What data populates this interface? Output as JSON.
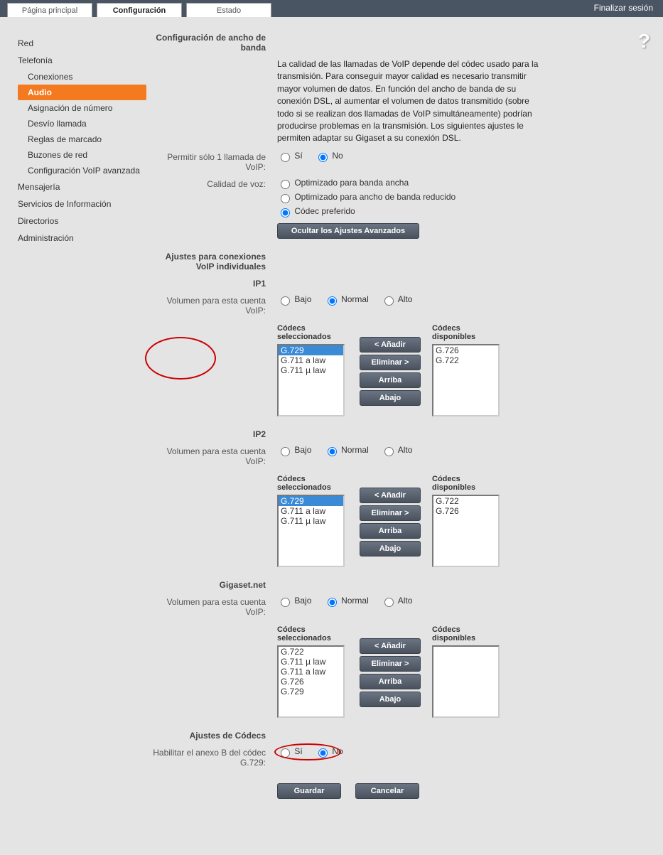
{
  "topbar": {
    "tabs": [
      "Página principal",
      "Configuración",
      "Estado"
    ],
    "logout": "Finalizar sesión"
  },
  "sidebar": {
    "red": "Red",
    "telefonia": "Telefonía",
    "telefonia_items": {
      "conexiones": "Conexiones",
      "audio": "Audio",
      "asignacion": "Asignación de número",
      "desvio": "Desvío llamada",
      "reglas": "Reglas de marcado",
      "buzones": "Buzones de red",
      "avanzada": "Configuración VoIP avanzada"
    },
    "mensajeria": "Mensajería",
    "servicios": "Servicios de Información",
    "directorios": "Directorios",
    "administracion": "Administración"
  },
  "content": {
    "heading_banda": "Configuración de ancho de banda",
    "desc": "La calidad de las llamadas de VoIP depende del códec usado para la transmisión. Para conseguir mayor calidad es necesario transmitir mayor volumen de datos. En función del ancho de banda de su conexión DSL, al aumentar el volumen de datos transmitido (sobre todo si se realizan dos llamadas de VoIP simultáneamente) podrían producirse problemas en la transmisión. Los siguientes ajustes le permiten adaptar su Gigaset a su conexión DSL.",
    "permitir_label": "Permitir sólo 1 llamada de VoIP:",
    "si": "Sí",
    "no": "No",
    "calidad_label": "Calidad de voz:",
    "calidad_opts": {
      "ancha": "Optimizado para banda ancha",
      "reducido": "Optimizado para ancho de banda reducido",
      "preferido": "Códec preferido"
    },
    "ocultar": "Ocultar los Ajustes Avanzados",
    "heading_individuales": "Ajustes para conexiones VoIP individuales",
    "ip1": "IP1",
    "ip2": "IP2",
    "gigasetnet": "Gigaset.net",
    "volumen_label": "Volumen para esta cuenta VoIP:",
    "bajo": "Bajo",
    "normal": "Normal",
    "alto": "Alto",
    "codecs_sel": "Códecs seleccionados",
    "codecs_disp": "Códecs disponibles",
    "anadir": "< Añadir",
    "eliminar": "Eliminar >",
    "arriba": "Arriba",
    "abajo": "Abajo",
    "ip1_sel": [
      "G.729",
      "G.711 a law",
      "G.711 µ law"
    ],
    "ip1_disp": [
      "G.726",
      "G.722"
    ],
    "ip2_sel": [
      "G.729",
      "G.711 a law",
      "G.711 µ law"
    ],
    "ip2_disp": [
      "G.722",
      "G.726"
    ],
    "gnet_sel": [
      "G.722",
      "G.711 µ law",
      "G.711 a law",
      "G.726",
      "G.729"
    ],
    "gnet_disp": [],
    "ajustes_codecs": "Ajustes de Códecs",
    "anexo_label": "Habilitar el anexo B del códec G.729:",
    "guardar": "Guardar",
    "cancelar": "Cancelar"
  }
}
